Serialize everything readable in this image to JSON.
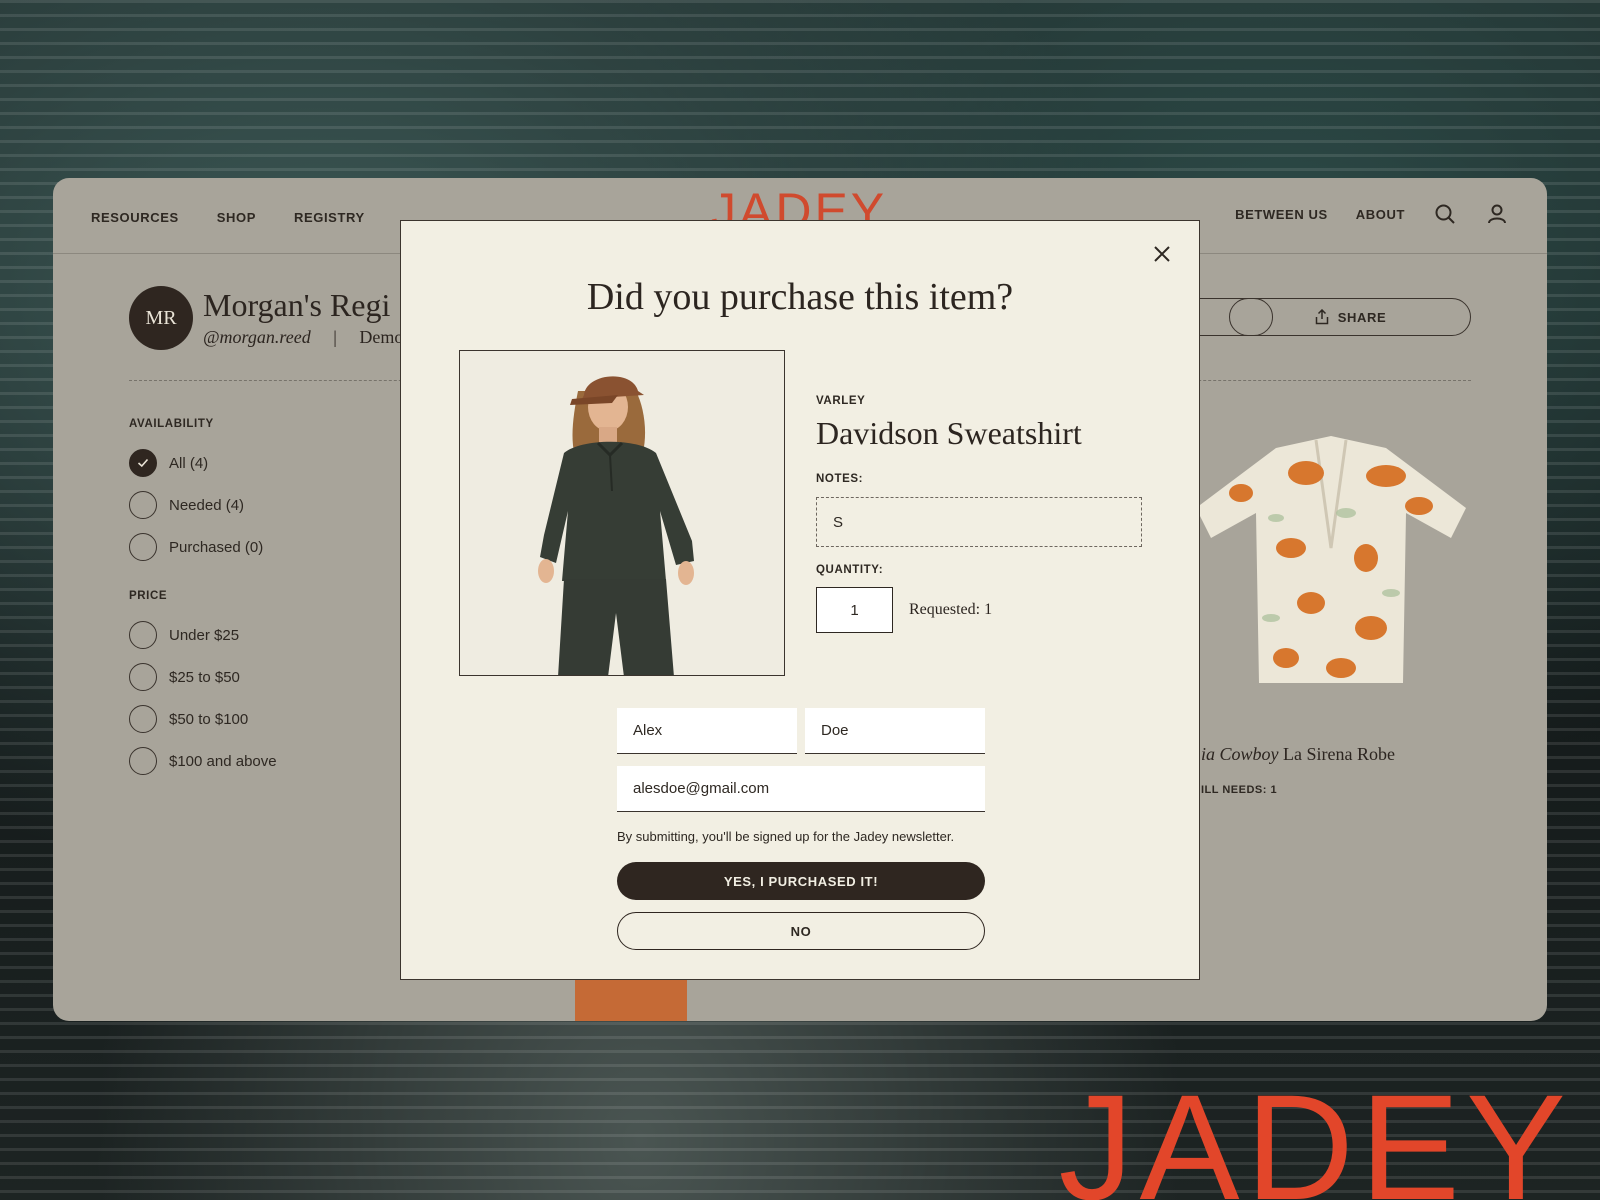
{
  "nav": {
    "left": [
      "RESOURCES",
      "SHOP",
      "REGISTRY"
    ],
    "logo": "JADEY",
    "right": [
      "BETWEEN US",
      "ABOUT"
    ],
    "icons": [
      "search-icon",
      "user-icon"
    ]
  },
  "profile": {
    "initials": "MR",
    "title": "Morgan's Regi",
    "handle": "@morgan.reed",
    "separator": "|",
    "sub": "Demo"
  },
  "actions": {
    "share_label": "SHARE"
  },
  "filters": {
    "availability_title": "AVAILABILITY",
    "availability": [
      {
        "label": "All (4)",
        "checked": true
      },
      {
        "label": "Needed (4)",
        "checked": false
      },
      {
        "label": "Purchased (0)",
        "checked": false
      }
    ],
    "price_title": "PRICE",
    "price": [
      {
        "label": "Under $25"
      },
      {
        "label": "$25 to $50"
      },
      {
        "label": "$50 to $100"
      },
      {
        "label": "$100 and above"
      }
    ]
  },
  "background_product": {
    "brand_italic": "ia Cowboy",
    "name": "La Sirena Robe",
    "still_needs": "ILL NEEDS: 1"
  },
  "modal": {
    "title": "Did you purchase this item?",
    "brand": "VARLEY",
    "item_name": "Davidson Sweatshirt",
    "notes_label": "NOTES:",
    "notes_value": "S",
    "quantity_label": "QUANTITY:",
    "quantity_value": "1",
    "requested": "Requested: 1",
    "first_name": "Alex",
    "last_name": "Doe",
    "email": "alesdoe@gmail.com",
    "disclaimer": "By submitting, you'll be signed up for the Jadey newsletter.",
    "confirm_label": "YES, I PURCHASED IT!",
    "decline_label": "NO"
  },
  "watermark": "JADEY",
  "colors": {
    "brand_red": "#e2462a",
    "dark": "#2f2620",
    "modal_bg": "#f2efe3",
    "app_bg": "#a8a49a"
  }
}
